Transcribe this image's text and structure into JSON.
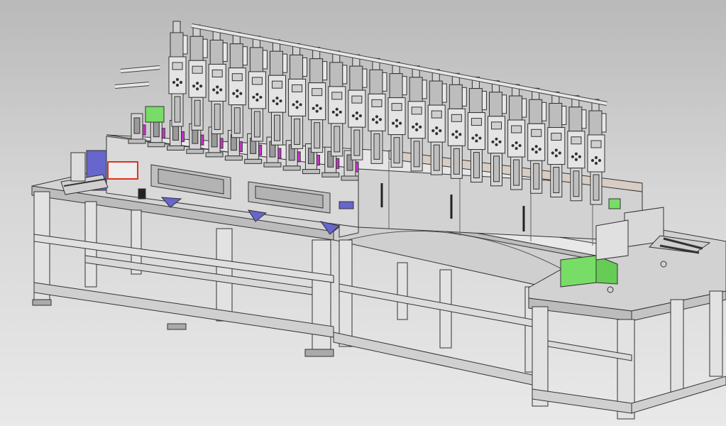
{
  "view": {
    "type": "cad-3d-model-viewport",
    "background": {
      "top": "#b9b9b9",
      "bottom": "#e9e9e9"
    }
  },
  "model": {
    "colors": {
      "frame_fill": "#e2e2e2",
      "frame_edge": "#333333",
      "plate_fill": "#cfcfcf",
      "machine_body": "#dadada",
      "warm_panel": "#d8cdc4",
      "green_part": "#77dd66",
      "blue_part": "#6666cc",
      "magenta_part": "#cc33cc",
      "red_part": "#dd3322",
      "stack_dark": "#bdbdbd"
    },
    "ultrasonic_heads": {
      "count": 22,
      "visible_label_text": ""
    }
  }
}
